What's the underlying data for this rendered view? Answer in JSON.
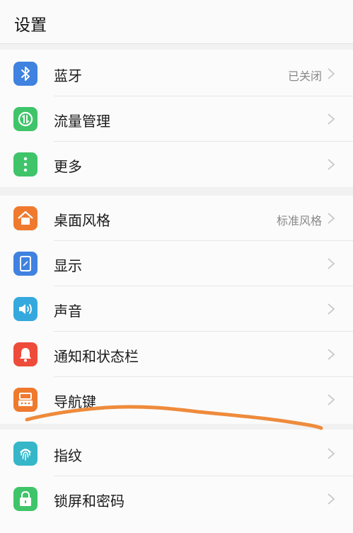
{
  "header": {
    "title": "设置"
  },
  "groups": [
    {
      "items": [
        {
          "label": "蓝牙",
          "value": "已关闭",
          "icon": "bluetooth-icon",
          "color": "#3f82e0"
        },
        {
          "label": "流量管理",
          "value": "",
          "icon": "data-usage-icon",
          "color": "#3fc46a"
        },
        {
          "label": "更多",
          "value": "",
          "icon": "more-icon",
          "color": "#3fc46a"
        }
      ]
    },
    {
      "items": [
        {
          "label": "桌面风格",
          "value": "标准风格",
          "icon": "home-style-icon",
          "color": "#ef7a2e"
        },
        {
          "label": "显示",
          "value": "",
          "icon": "display-icon",
          "color": "#3f82e0"
        },
        {
          "label": "声音",
          "value": "",
          "icon": "sound-icon",
          "color": "#35a9de"
        },
        {
          "label": "通知和状态栏",
          "value": "",
          "icon": "notification-bell-icon",
          "color": "#ef4b3b"
        },
        {
          "label": "导航键",
          "value": "",
          "icon": "navigation-key-icon",
          "color": "#ef7a2e"
        }
      ]
    },
    {
      "items": [
        {
          "label": "指纹",
          "value": "",
          "icon": "fingerprint-icon",
          "color": "#35b7c9"
        },
        {
          "label": "锁屏和密码",
          "value": "",
          "icon": "lock-icon",
          "color": "#3fc46a"
        }
      ]
    }
  ],
  "annotation": {
    "stroke_color": "#ee8b3c"
  }
}
